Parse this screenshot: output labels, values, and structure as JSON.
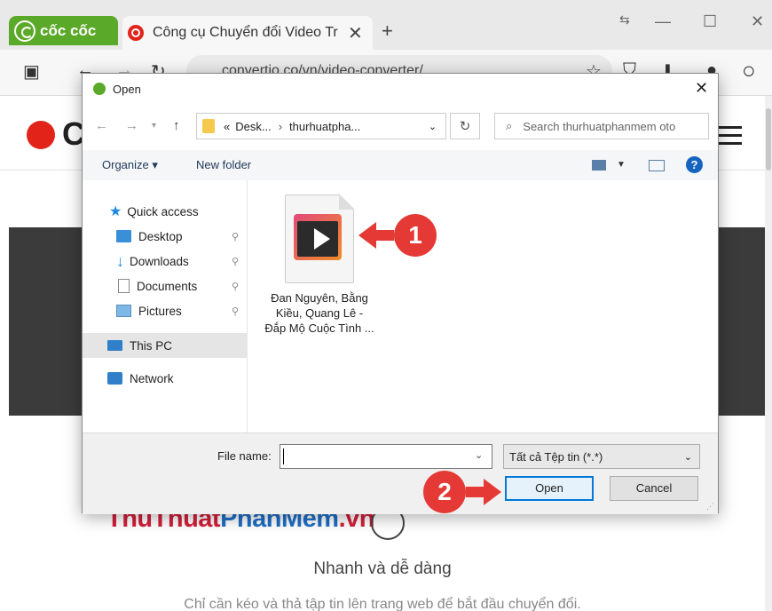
{
  "browser": {
    "brand": "cốc cốc",
    "tab_title": "Công cụ Chuyển đổi Video Tr",
    "url": "convertio.co/vn/video-converter/"
  },
  "page": {
    "subtitle": "Nhanh và dễ dàng",
    "description": "Chỉ cần kéo và thả tập tin lên trang web để bắt đầu chuyển đổi.",
    "watermark_a": "ThuThuat",
    "watermark_b": "PhanMem",
    "watermark_c": ".vn"
  },
  "dialog": {
    "title": "Open",
    "breadcrumb": {
      "prefix": "«",
      "parts": [
        "Desk...",
        "thurhuatpha..."
      ]
    },
    "search_placeholder": "Search thurhuatphanmem oto",
    "commands": {
      "organize": "Organize ▾",
      "new_folder": "New folder"
    },
    "nav_items": [
      {
        "label": "Quick access",
        "icon": "star-icon"
      },
      {
        "label": "Desktop",
        "icon": "desktop-icon",
        "pinned": true
      },
      {
        "label": "Downloads",
        "icon": "download-icon",
        "pinned": true
      },
      {
        "label": "Documents",
        "icon": "document-icon",
        "pinned": true
      },
      {
        "label": "Pictures",
        "icon": "pictures-icon",
        "pinned": true
      },
      {
        "label": "This PC",
        "icon": "computer-icon",
        "selected": true
      },
      {
        "label": "Network",
        "icon": "network-icon"
      }
    ],
    "file": {
      "name": "Đan Nguyên, Bằng Kiều, Quang Lê - Đắp Mộ Cuộc Tình ...",
      "icon": "video-file-icon"
    },
    "filename_label": "File name:",
    "filename_value": "",
    "filter": "Tất cả Tệp tin (*.*)",
    "open_label": "Open",
    "cancel_label": "Cancel"
  },
  "annotations": {
    "step1": "1",
    "step2": "2",
    "color": "#e53935"
  }
}
